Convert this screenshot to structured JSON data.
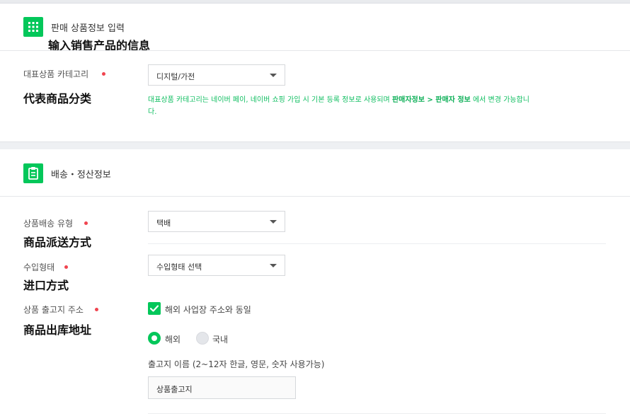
{
  "section1": {
    "title": "판매 상품정보 입력",
    "annotation": "输入销售产品的信息",
    "icon": "grid-icon"
  },
  "category": {
    "label": "대표상품 카테고리",
    "annotation": "代表商品分类",
    "value": "디지털/가전",
    "hint_part1": "대표상품 카테고리는 네이버 페이, 네이버 쇼핑 가입 시 기본 등록 정보로 사용되며 ",
    "hint_bold": "판매자정보 > 판매자 정보",
    "hint_part2": " 에서 변경 가능합니",
    "hint_part3": "다."
  },
  "section2": {
    "title": "배송・정산정보",
    "icon": "clipboard-icon"
  },
  "shipping_type": {
    "label": "상품배송 유형",
    "annotation": "商品派送方式",
    "value": "택배"
  },
  "import_type": {
    "label": "수입형태",
    "annotation": "进口方式",
    "value": "수입형태 선택"
  },
  "origin_address": {
    "label": "상품 출고지 주소",
    "annotation": "商品出库地址",
    "checkbox_label": "해외 사업장 주소와 동일",
    "checkbox_checked": true,
    "radio_overseas": "해외",
    "radio_domestic": "국내",
    "selected_radio": "해외",
    "name_label": "출고지 이름 (2~12자 한글, 영문, 숫자 사용가능)",
    "name_value": "상품출고지"
  },
  "colors": {
    "accent": "#03c75a",
    "required_dot": "#f0444f",
    "hint_text": "#0fbe60"
  }
}
